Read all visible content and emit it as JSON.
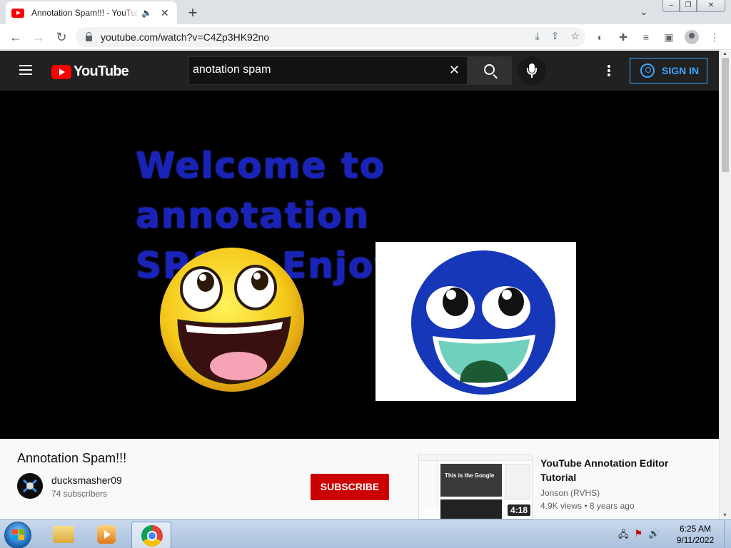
{
  "browser": {
    "tab_title": "Annotation Spam!!! - YouTube",
    "audio_icon": "speaker-icon",
    "url": "youtube.com/watch?v=C4Zp3HK92no"
  },
  "youtube": {
    "logo_text": "YouTube",
    "search_value": "anotation spam",
    "sign_in_label": "SIGN IN",
    "accent_color": "#3ea6ff",
    "brand_red": "#ff0000"
  },
  "video": {
    "overlay_text_line1": "Welcome to annotation",
    "overlay_text_line2": "SPAM. Enjoy!",
    "text_color": "#1a23b8"
  },
  "info": {
    "title": "Annotation Spam!!!",
    "channel_name": "ducksmasher09",
    "subscribers": "74 subscribers",
    "subscribe_label": "SUBSCRIBE",
    "subscribe_color": "#cc0000"
  },
  "recommended": {
    "thumb_caption": "This is the Google",
    "duration": "4:18",
    "title": "YouTube Annotation Editor Tutorial",
    "channel": "Jonson (RVHS)",
    "views": "4.9K views",
    "age": "8 years ago"
  },
  "taskbar": {
    "time": "6:25 AM",
    "date": "9/11/2022"
  }
}
